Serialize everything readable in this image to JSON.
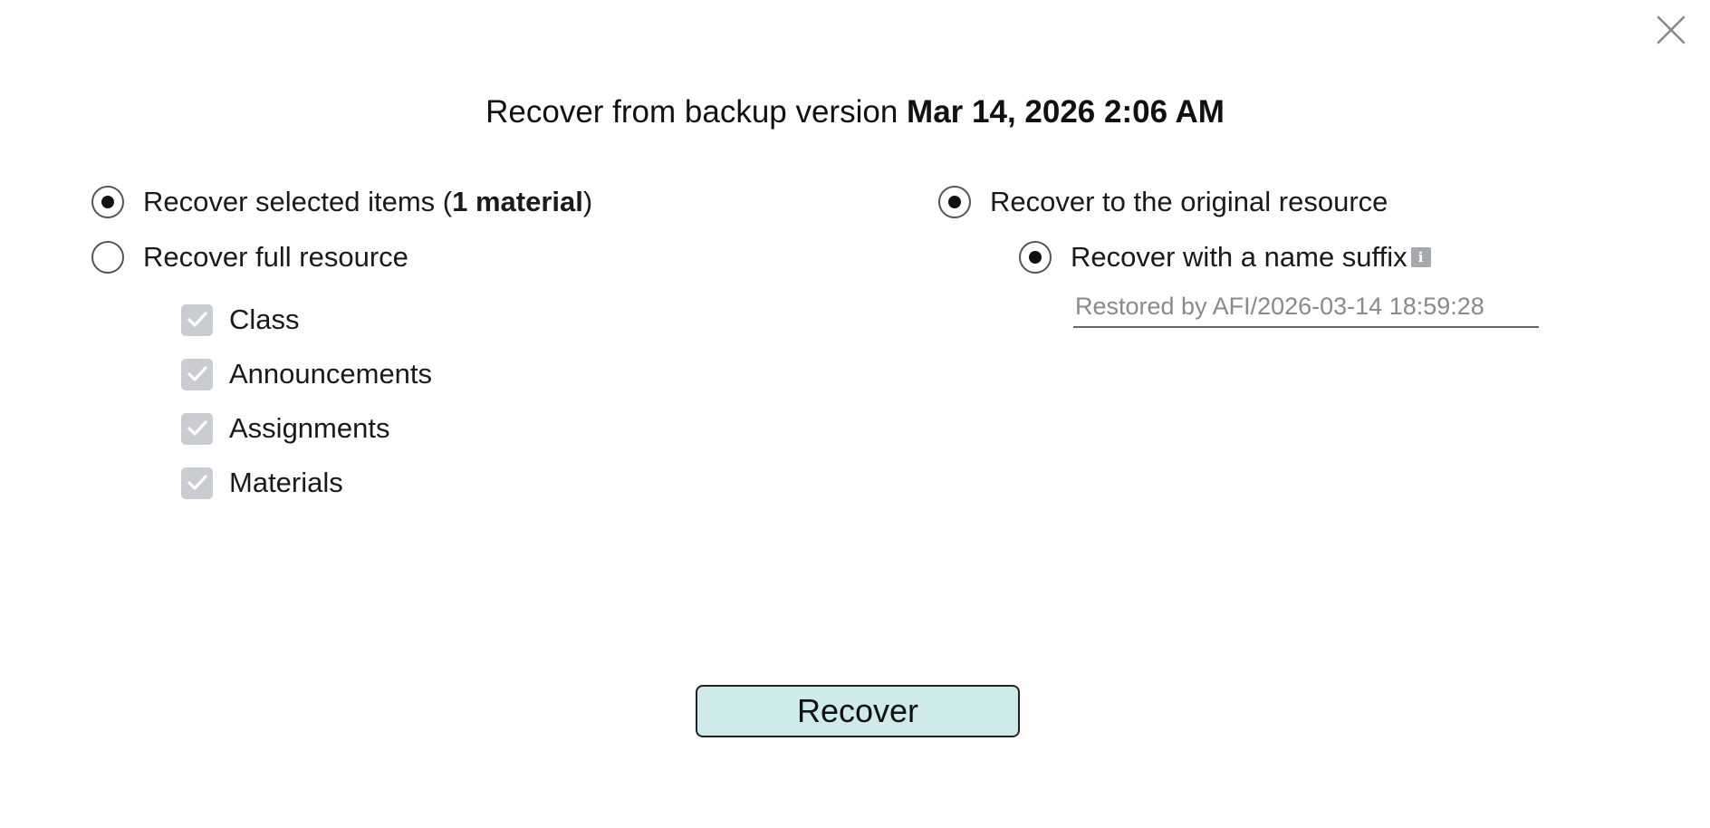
{
  "dialog": {
    "title_prefix": "Recover from backup version",
    "title_version": "Mar 14, 2026 2:06 AM",
    "close_icon": "close-icon"
  },
  "scope": {
    "selected_items": {
      "label_prefix": "Recover selected items (",
      "label_bold": "1 material",
      "label_suffix": ")",
      "checked": true
    },
    "full_resource": {
      "label": "Recover full resource",
      "checked": false
    },
    "components": [
      {
        "label": "Class",
        "checked": true,
        "disabled": true
      },
      {
        "label": "Announcements",
        "checked": true,
        "disabled": true
      },
      {
        "label": "Assignments",
        "checked": true,
        "disabled": true
      },
      {
        "label": "Materials",
        "checked": true,
        "disabled": true
      }
    ]
  },
  "destination": {
    "original_resource": {
      "label": "Recover to the original resource",
      "checked": true
    },
    "name_suffix": {
      "label": "Recover with a name suffix",
      "checked": true,
      "info_icon": "info-icon"
    },
    "suffix_input": {
      "value": "",
      "placeholder": "Restored by AFI/2026-03-14 18:59:28"
    }
  },
  "actions": {
    "recover_label": "Recover"
  },
  "colors": {
    "button_bg": "#cfeaea",
    "checkbox_disabled": "#c9ccd1"
  }
}
